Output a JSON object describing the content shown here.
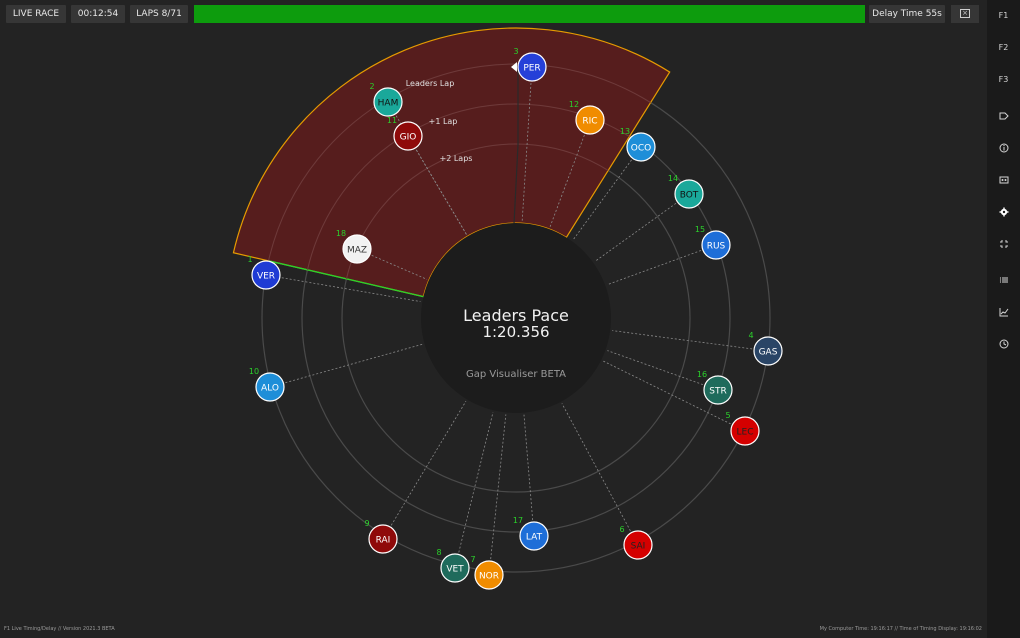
{
  "topbar": {
    "live_race_label": "LIVE RACE",
    "session_time": "00:12:54",
    "laps_label": "LAPS 8/71",
    "progress_fraction": 1.0,
    "delay_label": "Delay Time 55s"
  },
  "sidebar": {
    "items": [
      {
        "label": "F1",
        "icon": "f1-text"
      },
      {
        "label": "F2",
        "icon": "f2-text"
      },
      {
        "label": "F3",
        "icon": "f3-text"
      },
      {
        "label": "",
        "icon": "tag-icon"
      },
      {
        "label": "",
        "icon": "info-icon"
      },
      {
        "label": "",
        "icon": "tv-icon"
      },
      {
        "label": "",
        "icon": "settings-gear-icon"
      },
      {
        "label": "",
        "icon": "compress-icon"
      },
      {
        "label": "",
        "icon": "list-icon"
      },
      {
        "label": "",
        "icon": "chart-icon"
      },
      {
        "label": "",
        "icon": "lap-icon"
      }
    ]
  },
  "visualiser": {
    "title": "Leaders Pace",
    "leader_pace": "1:20.356",
    "subtitle": "Gap Visualiser BETA",
    "ring_labels": [
      "Leaders Lap",
      "+1 Lap",
      "+2 Laps"
    ],
    "drivers": [
      {
        "code": "VER",
        "pos": "1",
        "color": "#1f3bd4",
        "text": "#ffffff"
      },
      {
        "code": "HAM",
        "pos": "2",
        "color": "#1aa89a",
        "text": "#111111"
      },
      {
        "code": "PER",
        "pos": "3",
        "color": "#2540d8",
        "text": "#ffffff"
      },
      {
        "code": "GAS",
        "pos": "4",
        "color": "#2a4566",
        "text": "#ffffff"
      },
      {
        "code": "LEC",
        "pos": "5",
        "color": "#d40000",
        "text": "#222222"
      },
      {
        "code": "SAI",
        "pos": "6",
        "color": "#d40000",
        "text": "#222222"
      },
      {
        "code": "NOR",
        "pos": "7",
        "color": "#f08c00",
        "text": "#ffffff"
      },
      {
        "code": "VET",
        "pos": "8",
        "color": "#1f6b5c",
        "text": "#ffffff"
      },
      {
        "code": "RAI",
        "pos": "9",
        "color": "#8f0a0a",
        "text": "#ffffff"
      },
      {
        "code": "ALO",
        "pos": "10",
        "color": "#1e8ed8",
        "text": "#ffffff"
      },
      {
        "code": "GIO",
        "pos": "11",
        "color": "#8f0a0a",
        "text": "#ffffff"
      },
      {
        "code": "RIC",
        "pos": "12",
        "color": "#f08c00",
        "text": "#ffffff"
      },
      {
        "code": "OCO",
        "pos": "13",
        "color": "#1e8ed8",
        "text": "#ffffff"
      },
      {
        "code": "BOT",
        "pos": "14",
        "color": "#1aa89a",
        "text": "#111111"
      },
      {
        "code": "RUS",
        "pos": "15",
        "color": "#1e6ed8",
        "text": "#ffffff"
      },
      {
        "code": "STR",
        "pos": "16",
        "color": "#1f6b5c",
        "text": "#ffffff"
      },
      {
        "code": "LAT",
        "pos": "17",
        "color": "#1e6ed8",
        "text": "#ffffff"
      },
      {
        "code": "MAZ",
        "pos": "18",
        "color": "#f2f2f2",
        "text": "#333333"
      }
    ]
  },
  "colors": {
    "background": "#232323",
    "sector_fill": "#5c1d1d",
    "sector_border": "#e69b00",
    "leader_line": "#2bd12b",
    "ring": "#4a4a4a",
    "position_number": "#2bd12b",
    "progress": "#0d9c0d"
  },
  "footer": {
    "left": "F1 Live Timing/Delay // Version 2021.3 BETA",
    "right": "My Computer Time: 19:16:17 // Time of Timing Display: 19:16:02"
  }
}
